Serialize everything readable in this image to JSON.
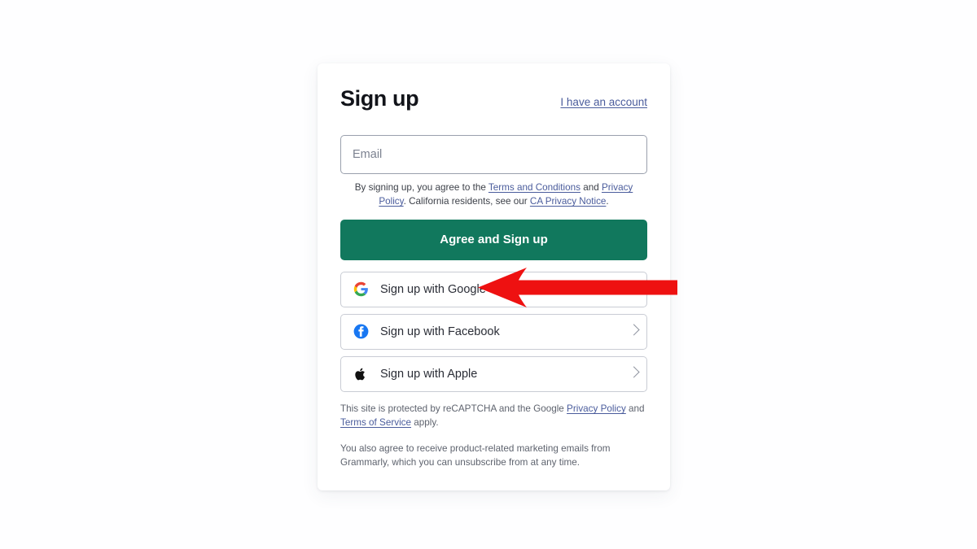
{
  "page": {
    "background_color": "#fefeff",
    "card_background": "#ffffff"
  },
  "header": {
    "title": "Sign up",
    "account_link": "I have an account"
  },
  "form": {
    "email": {
      "placeholder": "Email",
      "value": ""
    },
    "legal": {
      "part1": "By signing up, you agree to the ",
      "terms_link": "Terms and Conditions",
      "part2": " and ",
      "privacy_link": "Privacy Policy",
      "part3": ". California residents, see our ",
      "ca_link": "CA Privacy Notice",
      "part4": "."
    },
    "submit_label": "Agree and Sign up",
    "submit_color": "#11785d"
  },
  "social": {
    "buttons": [
      {
        "label": "Sign up with Google",
        "icon": "google-icon",
        "chevron_visible": false
      },
      {
        "label": "Sign up with Facebook",
        "icon": "facebook-icon",
        "chevron_visible": true
      },
      {
        "label": "Sign up with Apple",
        "icon": "apple-icon",
        "chevron_visible": true
      }
    ]
  },
  "fineprint": {
    "recaptcha": {
      "part1": "This site is protected by reCAPTCHA and the Google ",
      "privacy_link": "Privacy Policy",
      "part2": " and ",
      "terms_link": "Terms of Service",
      "part3": " apply."
    },
    "marketing": "You also agree to receive product-related marketing emails from Grammarly, which you can unsubscribe from at any time."
  },
  "annotation": {
    "arrow_color": "#ee1111",
    "points_to": "Sign up with Google",
    "direction": "left"
  }
}
